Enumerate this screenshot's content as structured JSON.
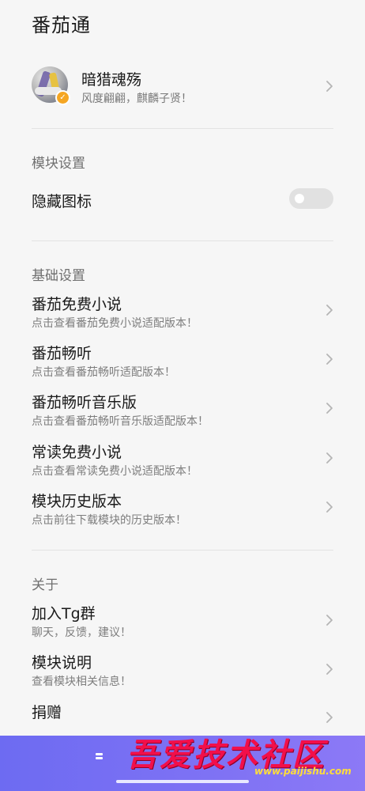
{
  "app": {
    "title": "番茄通"
  },
  "profile": {
    "name": "暗猎魂殇",
    "subtitle": "风度翩翩，麒麟子贤！"
  },
  "sections": {
    "module": {
      "title": "模块设置",
      "hide_icon_label": "隐藏图标",
      "hide_icon_enabled": false
    },
    "basic": {
      "title": "基础设置",
      "items": [
        {
          "title": "番茄免费小说",
          "subtitle": "点击查看番茄免费小说适配版本！"
        },
        {
          "title": "番茄畅听",
          "subtitle": "点击查看番茄畅听适配版本！"
        },
        {
          "title": "番茄畅听音乐版",
          "subtitle": "点击查看番茄畅听音乐版适配版本！"
        },
        {
          "title": "常读免费小说",
          "subtitle": "点击查看常读免费小说适配版本！"
        },
        {
          "title": "模块历史版本",
          "subtitle": "点击前往下载模块的历史版本！"
        }
      ]
    },
    "about": {
      "title": "关于",
      "items": [
        {
          "title": "加入Tg群",
          "subtitle": "聊天，反馈，建议！"
        },
        {
          "title": "模块说明",
          "subtitle": "查看模块相关信息！"
        },
        {
          "title": "捐赠",
          "subtitle": ""
        }
      ]
    }
  },
  "watermark": {
    "text": "吾爱技术社区",
    "url": "www.paijishu.com"
  },
  "colors": {
    "bottom_bar": "#7470f3",
    "watermark": "#f20f4a",
    "watermark_url": "#ffdd3b"
  }
}
